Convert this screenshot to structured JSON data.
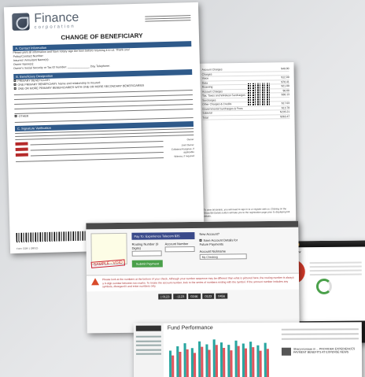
{
  "finance_form": {
    "brand_name": "Finance",
    "brand_sub": "corporation",
    "title": "CHANGE OF BENEFICIARY",
    "sections": [
      "A. Contact Information",
      "B. Beneficiary Designation",
      "C. Signature Verification"
    ],
    "intro": "Please print all information and have notary sign the form before returning it to us. Thank you!",
    "fields": [
      "Policy/Contract Number:",
      "Insured / Annuitant Name(s):",
      "Owner Name(s):",
      "Owner's Social Security or Tax ID Number:"
    ],
    "day_phone_label": "Day Telephone:",
    "options": [
      "PRIMARY BENEFICIARY",
      "ONE PRIMARY BENEFICIARY. Name and relationship to Insured:",
      "ONE OR MORE PRIMARY BENEFICIARIES WITH ONE OR MORE SECONDARY BENEFICIARIES",
      "OTHER"
    ],
    "signature_labels": [
      "Owner",
      "Joint Owner",
      "Collateral Assignee, if applicable",
      "Witness, if required"
    ],
    "date_label": "Date",
    "footer": "Form COB-1 (08/10)"
  },
  "statement": {
    "rows": [
      {
        "label": "Account Charges",
        "amount": "$40.00"
      },
      {
        "label": "Charges",
        "amount": ""
      },
      {
        "label": "Voice",
        "amount": "$12.00"
      },
      {
        "label": "Data",
        "amount": "$70.41"
      },
      {
        "label": "Roaming",
        "amount": "$21.00"
      },
      {
        "label": "Account Charges",
        "amount": "$0.00"
      },
      {
        "label": "Tax, Taxes and Wireless Surcharges",
        "amount": "$30.13"
      },
      {
        "label": "Surcharges",
        "amount": ""
      },
      {
        "label": "Other Charges & Credits",
        "amount": "$17.03"
      },
      {
        "label": "Governmental Surcharges & Fees",
        "amount": "$13.78"
      },
      {
        "label": "Subtotal",
        "amount": "$235.21"
      },
      {
        "label": "Total",
        "amount": "$363.47"
      }
    ],
    "note": "To view bill details, you will need to sign in to or register with us. Clicking on the Show Bill Details button will take you to the registration page prior to displaying bill details."
  },
  "payment": {
    "pay_to_label": "Pay To: Experience Telecom",
    "pay_to_value": "$35",
    "routing_label": "Routing Number (9 Digits)",
    "account_label": "Account Number",
    "new_account_label": "New Account?",
    "save_details_label": "Save Account Details for Future Payments",
    "nickname_label": "Account Nickname",
    "nickname_value": "My Checking",
    "submit_label": "Submit Payment",
    "stamp_text": "SAMPLE - VOID",
    "warning": "Please look at the numbers at the bottom of your check. Although your number sequence may be different than what is pictured here, the routing number is always a 9-digit number between two marks. To locate the account number, look to the series of numbers ending with the symbol. If the account number includes any symbols, disregard it and enter numbers only.",
    "check_numbers": [
      "|:0123",
      "::1123",
      "0246:",
      "0123",
      "0456"
    ]
  },
  "dashboard": {
    "title": "Summary View"
  },
  "fund": {
    "title": "Fund Performance",
    "news_text": "Sharp increase in ... PROVIDER EXPERIENCES PAYMENT BENEFITS AT EXPENSE NEWS"
  },
  "chart_data": {
    "type": "bar",
    "title": "Fund Performance",
    "categories": [
      "1",
      "2",
      "3",
      "4",
      "5",
      "6",
      "7",
      "8",
      "9",
      "10",
      "11",
      "12",
      "13",
      "14"
    ],
    "series": [
      {
        "values": [
          48,
          55,
          60,
          52,
          63,
          58,
          66,
          61,
          57,
          64,
          59,
          62,
          56,
          60
        ],
        "color": "#2aa6a0"
      },
      {
        "values": [
          40,
          46,
          50,
          44,
          54,
          49,
          57,
          52,
          48,
          55,
          51,
          53,
          47,
          50
        ],
        "color": "#e0555d"
      }
    ],
    "ylim": [
      0,
      70
    ]
  }
}
